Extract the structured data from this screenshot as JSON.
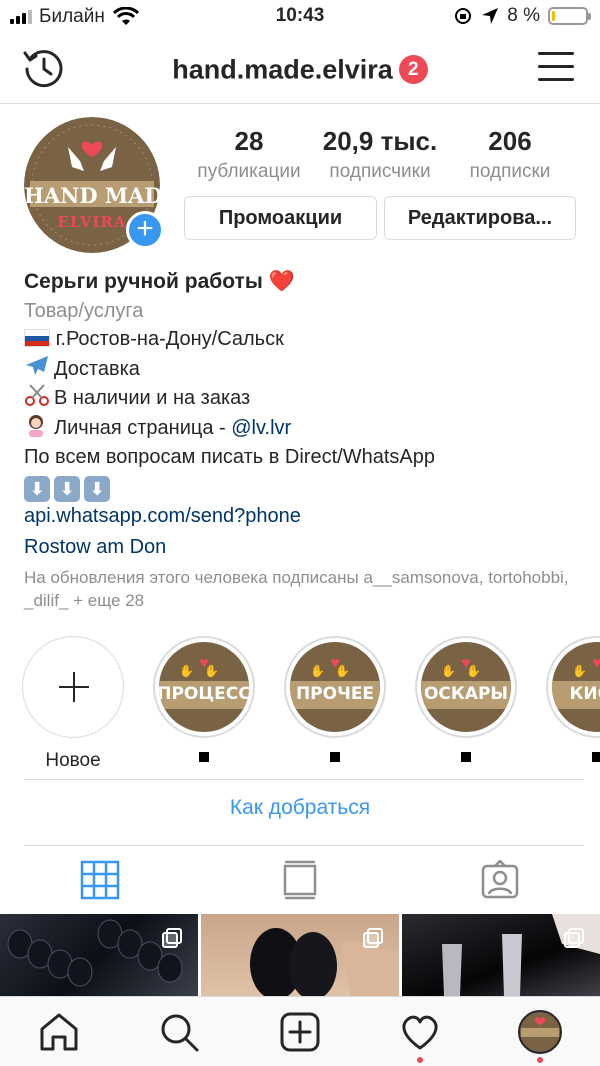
{
  "status": {
    "carrier": "Билайн",
    "time": "10:43",
    "battery_percent": "8 %",
    "battery_level": 0.08,
    "battery_color": "#f2c200"
  },
  "header": {
    "username": "hand.made.elvira",
    "notifications_count": "2",
    "history_icon": "history-icon",
    "menu_icon": "menu-icon"
  },
  "profile": {
    "avatar_text_top": "HAND MADE",
    "avatar_text_bottom": "ELVIRA",
    "stats": [
      {
        "value": "28",
        "label": "публикации"
      },
      {
        "value": "20,9 тыс.",
        "label": "подписчики"
      },
      {
        "value": "206",
        "label": "подписки"
      }
    ],
    "buttons": {
      "promo": "Промоакции",
      "edit": "Редактирова..."
    }
  },
  "bio": {
    "name": "Серьги ручной работы",
    "name_emoji": "❤️",
    "category": "Товар/услуга",
    "location": "г.Ростов-на-Дону/Сальск",
    "delivery": "Доставка",
    "stock": "В наличии и на заказ",
    "personal_prefix": "Личная страница - ",
    "personal_link": "@lv.lvr",
    "contact": "По всем вопросам писать в Direct/WhatsApp",
    "link": "api.whatsapp.com/send?phone",
    "address": "Rostow am Don",
    "followed_by": "На обновления этого человека подписаны a__samsonova, tortohobbi, _dilif_ + еще 28"
  },
  "highlights": [
    {
      "label": "Новое",
      "title": ""
    },
    {
      "label": "",
      "title": "ПРОЦЕСС"
    },
    {
      "label": "",
      "title": "ПРОЧЕЕ"
    },
    {
      "label": "",
      "title": "ОСКАРЫ"
    },
    {
      "label": "",
      "title": "КИОС"
    }
  ],
  "directions_label": "Как добраться",
  "colors": {
    "accent": "#3897f0",
    "badge": "#ed4956",
    "link": "#003569",
    "muted": "#8e8e8e"
  }
}
